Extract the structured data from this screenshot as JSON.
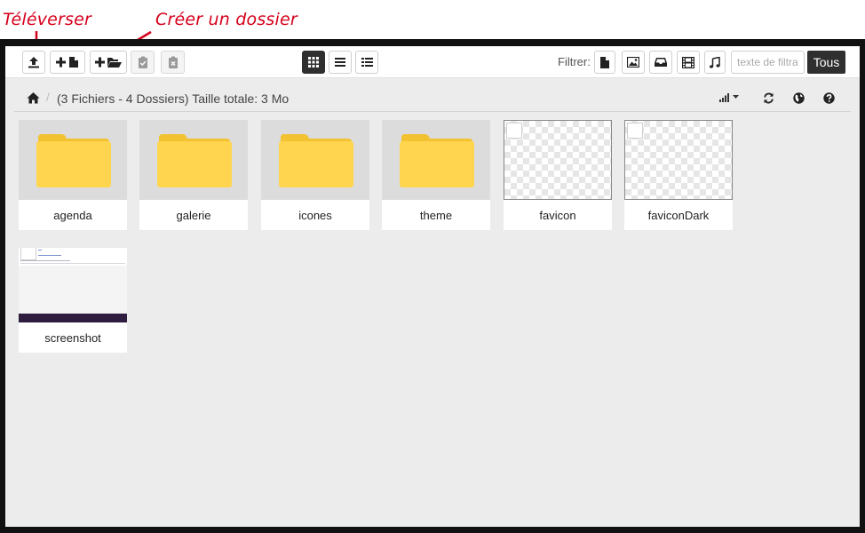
{
  "annotations": {
    "upload": "Téléverser",
    "create_folder": "Créer un dossier",
    "color": "#d6001c"
  },
  "toolbar": {
    "filter_label": "Filtrer:",
    "filter_placeholder": "texte de filtrage",
    "all_button": "Tous",
    "buttons": [
      {
        "name": "upload",
        "icon": "upload-icon"
      },
      {
        "name": "new-file",
        "icon": "plus-file-icon"
      },
      {
        "name": "new-folder",
        "icon": "plus-folder-icon"
      },
      {
        "name": "paste",
        "icon": "clipboard-check-icon",
        "state": "disabled"
      },
      {
        "name": "clear-clipboard",
        "icon": "clipboard-x-icon",
        "state": "disabled"
      },
      {
        "name": "grid-view",
        "icon": "grid-icon",
        "state": "active"
      },
      {
        "name": "list-view",
        "icon": "list-icon"
      },
      {
        "name": "columns-view",
        "icon": "columns-list-icon"
      },
      {
        "name": "filter-files",
        "icon": "file-icon"
      },
      {
        "name": "filter-images",
        "icon": "image-icon"
      },
      {
        "name": "filter-archives",
        "icon": "inbox-icon"
      },
      {
        "name": "filter-video",
        "icon": "film-icon"
      },
      {
        "name": "filter-music",
        "icon": "music-icon"
      }
    ]
  },
  "breadcrumb": {
    "summary": "(3 Fichiers - 4 Dossiers) Taille totale: 3 Mo",
    "separator": "/"
  },
  "items": [
    {
      "name": "agenda",
      "type": "folder"
    },
    {
      "name": "galerie",
      "type": "folder"
    },
    {
      "name": "icones",
      "type": "folder"
    },
    {
      "name": "theme",
      "type": "folder"
    },
    {
      "name": "favicon",
      "type": "image"
    },
    {
      "name": "faviconDark",
      "type": "image"
    },
    {
      "name": "screenshot",
      "type": "image"
    }
  ],
  "colors": {
    "folder": "#ffd54f",
    "folder_tab": "#f2c230",
    "toolbar_active": "#2f2f2f",
    "workspace": "#ececec"
  }
}
